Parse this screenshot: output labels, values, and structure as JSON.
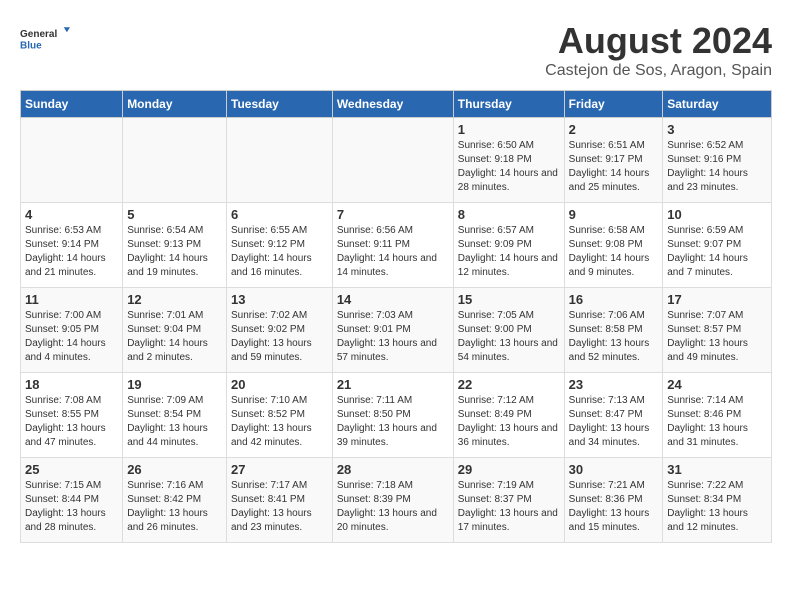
{
  "logo": {
    "line1": "General",
    "line2": "Blue"
  },
  "title": "August 2024",
  "subtitle": "Castejon de Sos, Aragon, Spain",
  "days_of_week": [
    "Sunday",
    "Monday",
    "Tuesday",
    "Wednesday",
    "Thursday",
    "Friday",
    "Saturday"
  ],
  "weeks": [
    {
      "days": [
        {
          "number": "",
          "info": ""
        },
        {
          "number": "",
          "info": ""
        },
        {
          "number": "",
          "info": ""
        },
        {
          "number": "",
          "info": ""
        },
        {
          "number": "1",
          "info": "Sunrise: 6:50 AM\nSunset: 9:18 PM\nDaylight: 14 hours and 28 minutes."
        },
        {
          "number": "2",
          "info": "Sunrise: 6:51 AM\nSunset: 9:17 PM\nDaylight: 14 hours and 25 minutes."
        },
        {
          "number": "3",
          "info": "Sunrise: 6:52 AM\nSunset: 9:16 PM\nDaylight: 14 hours and 23 minutes."
        }
      ]
    },
    {
      "days": [
        {
          "number": "4",
          "info": "Sunrise: 6:53 AM\nSunset: 9:14 PM\nDaylight: 14 hours and 21 minutes."
        },
        {
          "number": "5",
          "info": "Sunrise: 6:54 AM\nSunset: 9:13 PM\nDaylight: 14 hours and 19 minutes."
        },
        {
          "number": "6",
          "info": "Sunrise: 6:55 AM\nSunset: 9:12 PM\nDaylight: 14 hours and 16 minutes."
        },
        {
          "number": "7",
          "info": "Sunrise: 6:56 AM\nSunset: 9:11 PM\nDaylight: 14 hours and 14 minutes."
        },
        {
          "number": "8",
          "info": "Sunrise: 6:57 AM\nSunset: 9:09 PM\nDaylight: 14 hours and 12 minutes."
        },
        {
          "number": "9",
          "info": "Sunrise: 6:58 AM\nSunset: 9:08 PM\nDaylight: 14 hours and 9 minutes."
        },
        {
          "number": "10",
          "info": "Sunrise: 6:59 AM\nSunset: 9:07 PM\nDaylight: 14 hours and 7 minutes."
        }
      ]
    },
    {
      "days": [
        {
          "number": "11",
          "info": "Sunrise: 7:00 AM\nSunset: 9:05 PM\nDaylight: 14 hours and 4 minutes."
        },
        {
          "number": "12",
          "info": "Sunrise: 7:01 AM\nSunset: 9:04 PM\nDaylight: 14 hours and 2 minutes."
        },
        {
          "number": "13",
          "info": "Sunrise: 7:02 AM\nSunset: 9:02 PM\nDaylight: 13 hours and 59 minutes."
        },
        {
          "number": "14",
          "info": "Sunrise: 7:03 AM\nSunset: 9:01 PM\nDaylight: 13 hours and 57 minutes."
        },
        {
          "number": "15",
          "info": "Sunrise: 7:05 AM\nSunset: 9:00 PM\nDaylight: 13 hours and 54 minutes."
        },
        {
          "number": "16",
          "info": "Sunrise: 7:06 AM\nSunset: 8:58 PM\nDaylight: 13 hours and 52 minutes."
        },
        {
          "number": "17",
          "info": "Sunrise: 7:07 AM\nSunset: 8:57 PM\nDaylight: 13 hours and 49 minutes."
        }
      ]
    },
    {
      "days": [
        {
          "number": "18",
          "info": "Sunrise: 7:08 AM\nSunset: 8:55 PM\nDaylight: 13 hours and 47 minutes."
        },
        {
          "number": "19",
          "info": "Sunrise: 7:09 AM\nSunset: 8:54 PM\nDaylight: 13 hours and 44 minutes."
        },
        {
          "number": "20",
          "info": "Sunrise: 7:10 AM\nSunset: 8:52 PM\nDaylight: 13 hours and 42 minutes."
        },
        {
          "number": "21",
          "info": "Sunrise: 7:11 AM\nSunset: 8:50 PM\nDaylight: 13 hours and 39 minutes."
        },
        {
          "number": "22",
          "info": "Sunrise: 7:12 AM\nSunset: 8:49 PM\nDaylight: 13 hours and 36 minutes."
        },
        {
          "number": "23",
          "info": "Sunrise: 7:13 AM\nSunset: 8:47 PM\nDaylight: 13 hours and 34 minutes."
        },
        {
          "number": "24",
          "info": "Sunrise: 7:14 AM\nSunset: 8:46 PM\nDaylight: 13 hours and 31 minutes."
        }
      ]
    },
    {
      "days": [
        {
          "number": "25",
          "info": "Sunrise: 7:15 AM\nSunset: 8:44 PM\nDaylight: 13 hours and 28 minutes."
        },
        {
          "number": "26",
          "info": "Sunrise: 7:16 AM\nSunset: 8:42 PM\nDaylight: 13 hours and 26 minutes."
        },
        {
          "number": "27",
          "info": "Sunrise: 7:17 AM\nSunset: 8:41 PM\nDaylight: 13 hours and 23 minutes."
        },
        {
          "number": "28",
          "info": "Sunrise: 7:18 AM\nSunset: 8:39 PM\nDaylight: 13 hours and 20 minutes."
        },
        {
          "number": "29",
          "info": "Sunrise: 7:19 AM\nSunset: 8:37 PM\nDaylight: 13 hours and 17 minutes."
        },
        {
          "number": "30",
          "info": "Sunrise: 7:21 AM\nSunset: 8:36 PM\nDaylight: 13 hours and 15 minutes."
        },
        {
          "number": "31",
          "info": "Sunrise: 7:22 AM\nSunset: 8:34 PM\nDaylight: 13 hours and 12 minutes."
        }
      ]
    }
  ]
}
